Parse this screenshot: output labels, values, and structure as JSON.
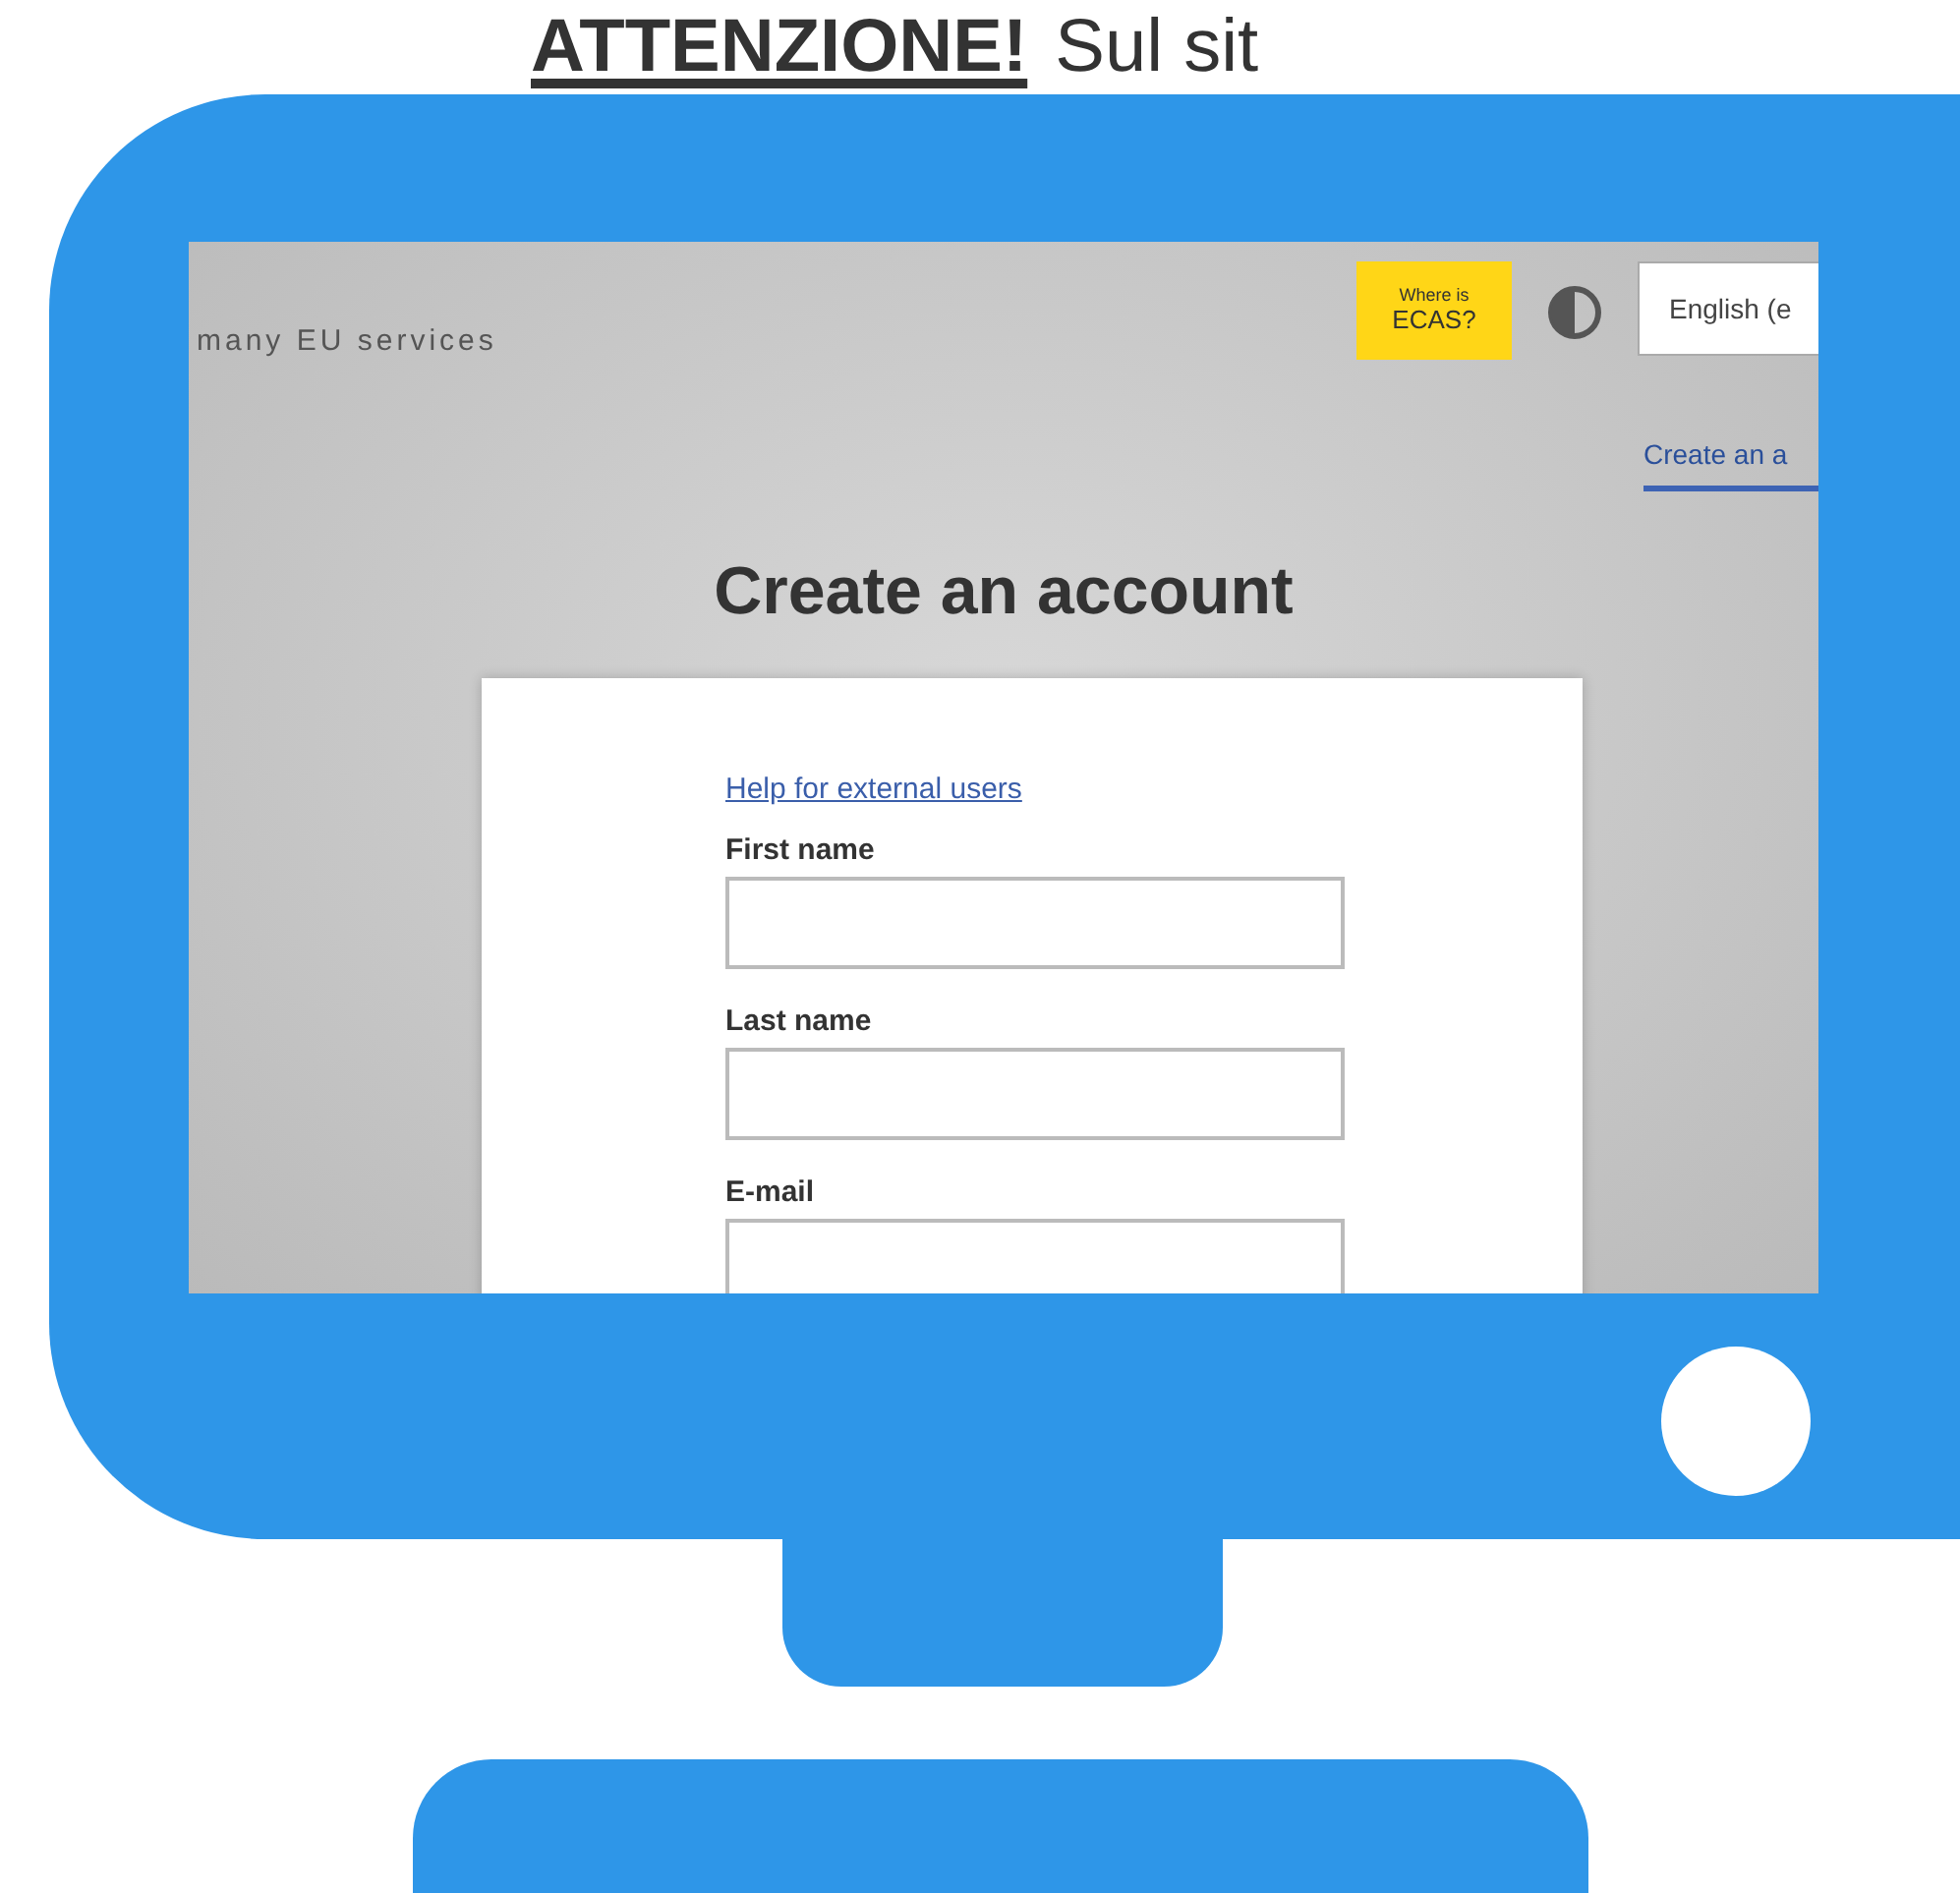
{
  "heading": {
    "alert": "ATTENZIONE!",
    "rest": "Sul sit"
  },
  "screen": {
    "tagline": "many EU services",
    "ecas_button": {
      "line_1": "Where is",
      "line_2": "ECAS?"
    },
    "language_select": {
      "value": "English (e"
    },
    "nav_tab": {
      "label": "Create an a",
      "selected": true
    },
    "title": "Create an account",
    "form": {
      "help_link": "Help for external users",
      "fields": [
        {
          "label": "First name"
        },
        {
          "label": "Last name"
        },
        {
          "label": "E-mail"
        }
      ]
    }
  }
}
